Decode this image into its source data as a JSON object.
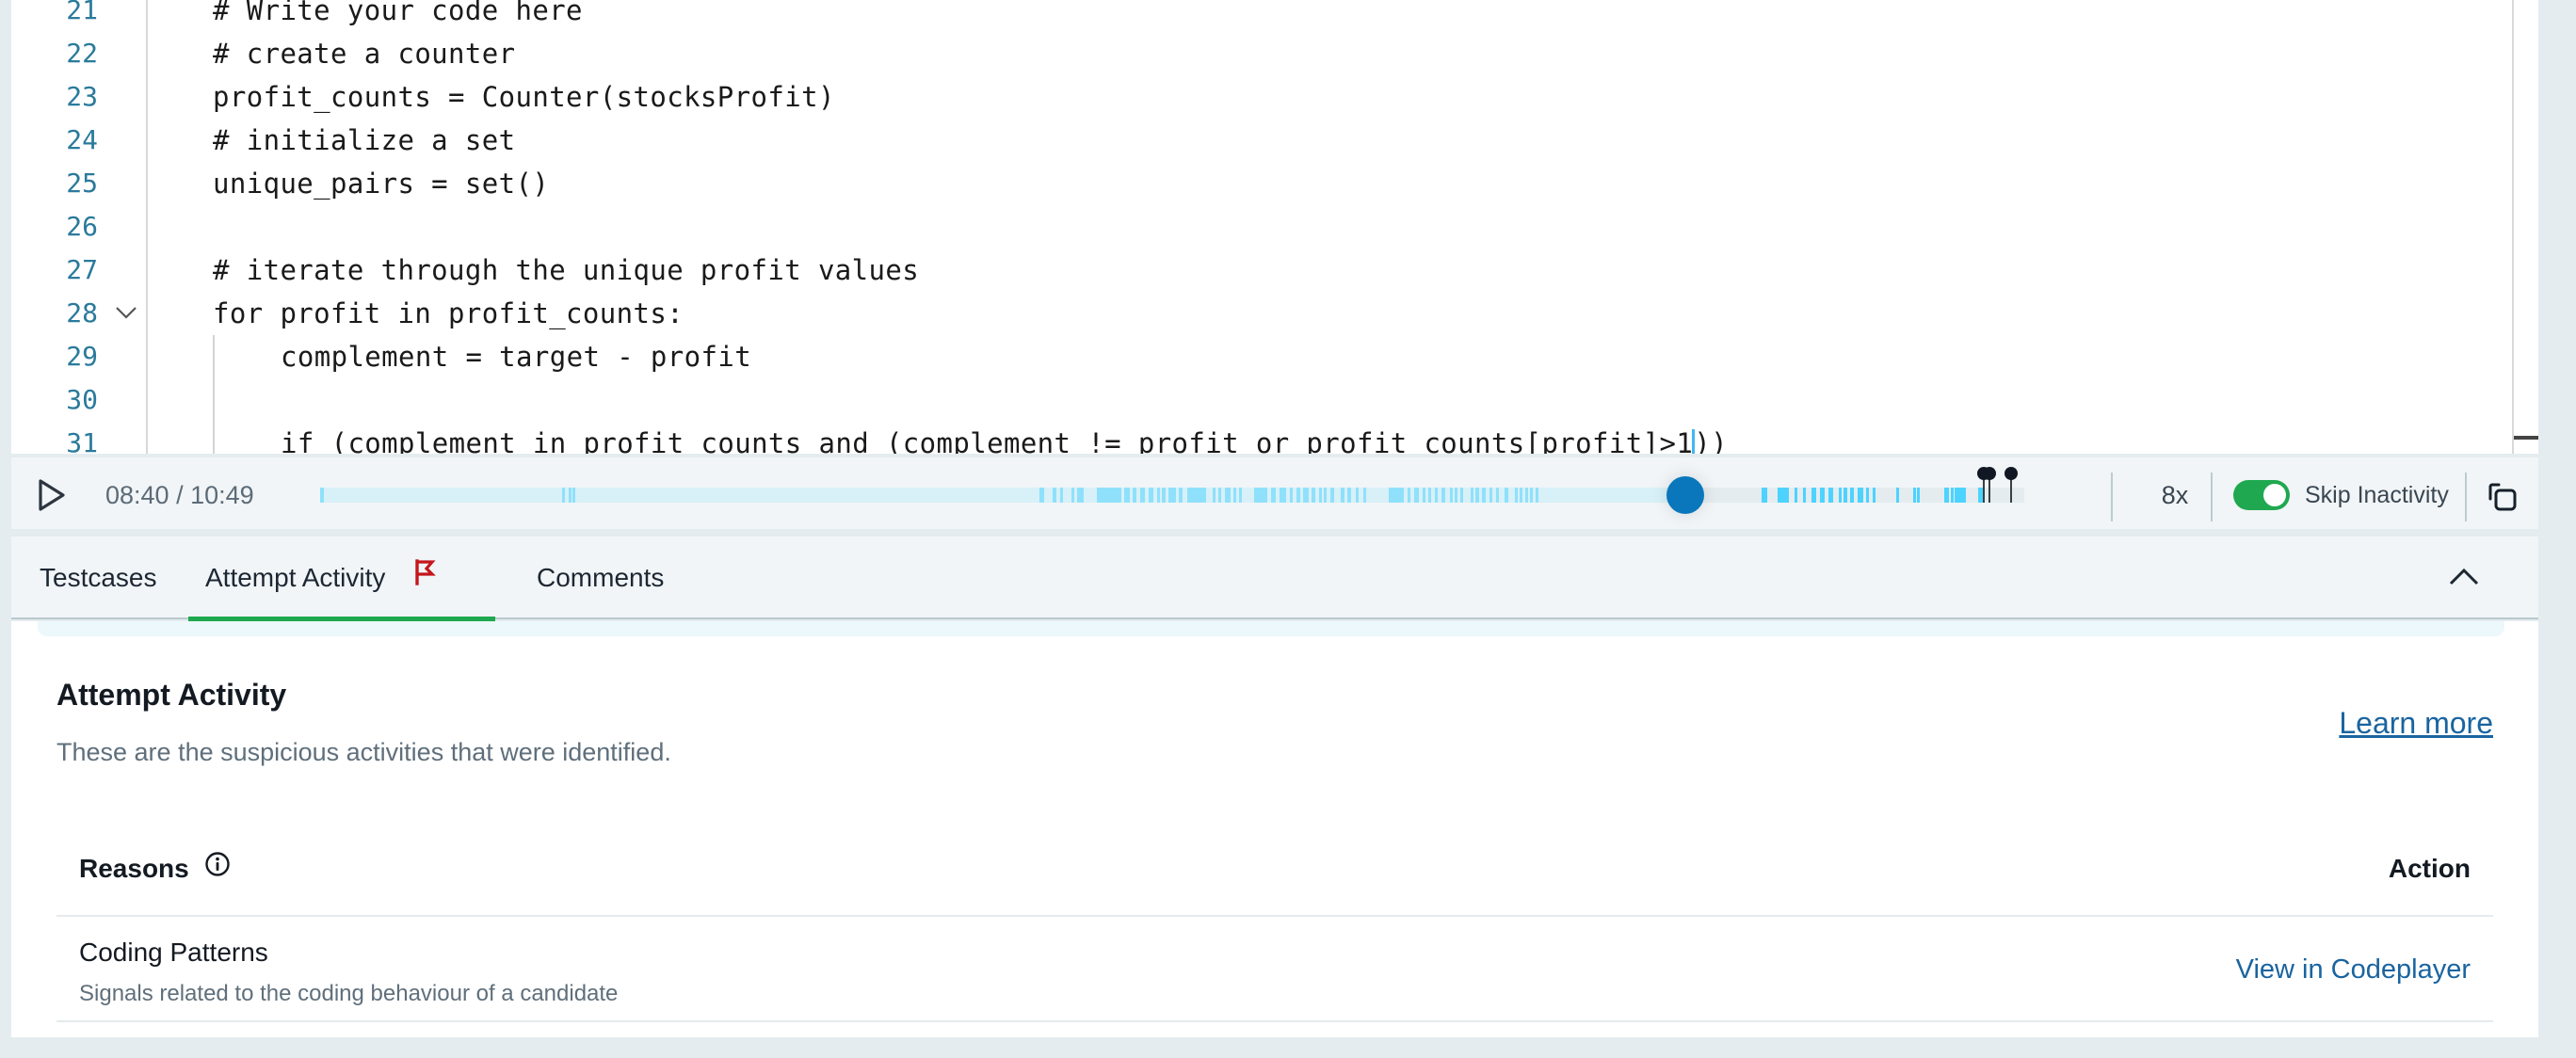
{
  "editor": {
    "lines": [
      {
        "number": "21",
        "code": "# Write your code here",
        "indent": 1
      },
      {
        "number": "22",
        "code": "# create a counter",
        "indent": 1
      },
      {
        "number": "23",
        "code": "profit_counts = Counter(stocksProfit)",
        "indent": 1
      },
      {
        "number": "24",
        "code": "# initialize a set",
        "indent": 1
      },
      {
        "number": "25",
        "code": "unique_pairs = set()",
        "indent": 1
      },
      {
        "number": "26",
        "code": "",
        "indent": 1
      },
      {
        "number": "27",
        "code": "# iterate through the unique profit values",
        "indent": 1
      },
      {
        "number": "28",
        "code": "for profit in profit_counts:",
        "indent": 1,
        "foldable": true
      },
      {
        "number": "29",
        "code": "complement = target - profit",
        "indent": 2
      },
      {
        "number": "30",
        "code": "",
        "indent": 2
      },
      {
        "number": "31",
        "code_before_cursor": "if (complement in profit_counts and (complement != profit or profit_counts[profit]>1",
        "code_after_cursor": "))",
        "indent": 2
      }
    ]
  },
  "player": {
    "current_time": "08:40",
    "total_time": "10:49",
    "time_display": "08:40 / 10:49",
    "progress": 0.801,
    "speed": "8x",
    "skip_inactivity_label": "Skip Inactivity",
    "skip_inactivity_on": true,
    "marker_positions": [
      0.9765,
      0.9795,
      0.992
    ],
    "activity_segments": [
      [
        0.0,
        0.002
      ],
      [
        0.142,
        0.143
      ],
      [
        0.146,
        0.147
      ],
      [
        0.148,
        0.149
      ],
      [
        0.422,
        0.425
      ],
      [
        0.43,
        0.432
      ],
      [
        0.434,
        0.436
      ],
      [
        0.441,
        0.442
      ],
      [
        0.444,
        0.448
      ],
      [
        0.456,
        0.47
      ],
      [
        0.472,
        0.475
      ],
      [
        0.477,
        0.479
      ],
      [
        0.481,
        0.484
      ],
      [
        0.486,
        0.489
      ],
      [
        0.491,
        0.492
      ],
      [
        0.494,
        0.496
      ],
      [
        0.498,
        0.502
      ],
      [
        0.504,
        0.506
      ],
      [
        0.509,
        0.52
      ],
      [
        0.524,
        0.525
      ],
      [
        0.527,
        0.529
      ],
      [
        0.531,
        0.534
      ],
      [
        0.536,
        0.537
      ],
      [
        0.539,
        0.54
      ],
      [
        0.548,
        0.556
      ],
      [
        0.558,
        0.561
      ],
      [
        0.563,
        0.567
      ],
      [
        0.569,
        0.571
      ],
      [
        0.573,
        0.575
      ],
      [
        0.577,
        0.58
      ],
      [
        0.582,
        0.584
      ],
      [
        0.586,
        0.587
      ],
      [
        0.589,
        0.59
      ],
      [
        0.593,
        0.595
      ],
      [
        0.599,
        0.601
      ],
      [
        0.603,
        0.605
      ],
      [
        0.608,
        0.609
      ],
      [
        0.612,
        0.613
      ],
      [
        0.627,
        0.636
      ],
      [
        0.638,
        0.64
      ],
      [
        0.642,
        0.645
      ],
      [
        0.647,
        0.648
      ],
      [
        0.65,
        0.652
      ],
      [
        0.654,
        0.656
      ],
      [
        0.658,
        0.66
      ],
      [
        0.663,
        0.664
      ],
      [
        0.666,
        0.667
      ],
      [
        0.669,
        0.67
      ],
      [
        0.675,
        0.676
      ],
      [
        0.678,
        0.68
      ],
      [
        0.682,
        0.684
      ],
      [
        0.686,
        0.688
      ],
      [
        0.69,
        0.691
      ],
      [
        0.695,
        0.697
      ],
      [
        0.701,
        0.702
      ],
      [
        0.704,
        0.705
      ],
      [
        0.707,
        0.708
      ],
      [
        0.71,
        0.711
      ],
      [
        0.713,
        0.714
      ],
      [
        0.846,
        0.849
      ],
      [
        0.855,
        0.862
      ],
      [
        0.865,
        0.867
      ],
      [
        0.87,
        0.872
      ],
      [
        0.875,
        0.878
      ],
      [
        0.88,
        0.883
      ],
      [
        0.885,
        0.888
      ],
      [
        0.891,
        0.892
      ],
      [
        0.894,
        0.896
      ],
      [
        0.898,
        0.9
      ],
      [
        0.902,
        0.903
      ],
      [
        0.904,
        0.905
      ],
      [
        0.907,
        0.909
      ],
      [
        0.911,
        0.912
      ],
      [
        0.925,
        0.926
      ],
      [
        0.935,
        0.936
      ],
      [
        0.937,
        0.938
      ],
      [
        0.953,
        0.956
      ],
      [
        0.957,
        0.958
      ],
      [
        0.959,
        0.966
      ],
      [
        0.973,
        0.976
      ]
    ],
    "colors": {
      "segment_played": "#8fe1fb",
      "segment_unplayed": "#4dd3ff",
      "thumb": "#0a77bd",
      "toggle_on": "#1fa84f"
    }
  },
  "tabs": [
    {
      "label": "Testcases",
      "active": false
    },
    {
      "label": "Attempt Activity",
      "active": true,
      "flagged": true
    },
    {
      "label": "Comments",
      "active": false
    }
  ],
  "attempt_activity": {
    "title": "Attempt Activity",
    "subtitle": "These are the suspicious activities that were identified.",
    "learn_more": "Learn more",
    "table": {
      "headers": {
        "reasons": "Reasons",
        "action": "Action"
      },
      "rows": [
        {
          "title": "Coding Patterns",
          "subtitle": "Signals related to the coding behaviour of a candidate",
          "action": "View in Codeplayer"
        }
      ]
    }
  },
  "icons": {
    "play": "play-icon",
    "fold": "chevron-down-icon",
    "flag": "flag-icon",
    "collapse": "chevron-up-icon",
    "info": "info-icon",
    "copy": "copy-icon"
  }
}
